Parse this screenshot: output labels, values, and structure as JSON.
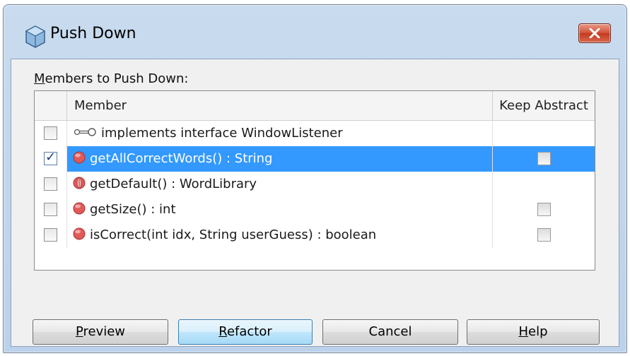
{
  "window": {
    "title": "Push Down"
  },
  "members_section": {
    "label_mnemonic": "M",
    "label_rest": "embers to Push Down:"
  },
  "table": {
    "columns": [
      "",
      "Member",
      "Keep Abstract"
    ],
    "rows": [
      {
        "checked": false,
        "icon": "interface-implements-icon",
        "label": "implements interface WindowListener",
        "keep_abstract": null,
        "selected": false
      },
      {
        "checked": true,
        "icon": "method-icon",
        "label": "getAllCorrectWords() : String",
        "keep_abstract": false,
        "selected": true
      },
      {
        "checked": false,
        "icon": "abstract-method-icon",
        "label": "getDefault() : WordLibrary",
        "keep_abstract": null,
        "selected": false
      },
      {
        "checked": false,
        "icon": "method-icon",
        "label": "getSize() : int",
        "keep_abstract": false,
        "selected": false
      },
      {
        "checked": false,
        "icon": "method-icon",
        "label": "isCorrect(int idx, String userGuess) : boolean",
        "keep_abstract": false,
        "selected": false
      }
    ]
  },
  "buttons": {
    "preview": {
      "mnemonic": "P",
      "rest": "review"
    },
    "refactor": {
      "mnemonic": "R",
      "rest": "efactor"
    },
    "cancel": {
      "label": "Cancel"
    },
    "help": {
      "mnemonic": "H",
      "rest": "elp"
    }
  },
  "colors": {
    "selection": "#3399ff",
    "method_icon": "#e05a5a",
    "close_button": "#c2391f"
  }
}
